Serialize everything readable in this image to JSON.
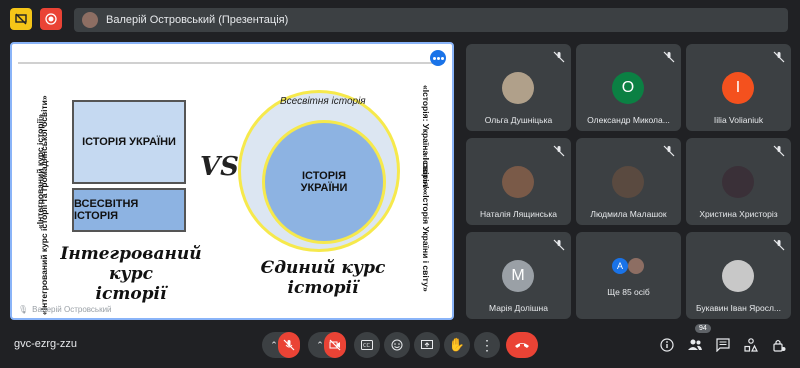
{
  "topbar": {
    "presenter_label": "Валерій Островський (Презентація)"
  },
  "slide": {
    "left_vertical_1": "«Інтегрований курс історії та громадянської освіти»",
    "left_vertical_2": "«Інтегрований курс історії»",
    "box_top": "ІСТОРІЯ УКРАЇНИ",
    "box_bottom": "ВСЕСВІТНЯ ІСТОРІЯ",
    "vs": "VS",
    "ring_outer_label": "Всесвітня історія",
    "ring_inner_label": "ІСТОРІЯ УКРАЇНИ",
    "right_vertical_1": "«Історія: Україна і світ» / «Історія України і світу»",
    "right_vertical_2": "«Історія»",
    "caption_left_1": "Інтегрований курс",
    "caption_left_2": "історії",
    "caption_right_1": "Єдиний курс",
    "caption_right_2": "історії",
    "watermark": "Валерій Островський"
  },
  "participants": [
    {
      "name": "Ольга Душніцька",
      "avatar": "photo",
      "color": "#b0a08a"
    },
    {
      "name": "Олександр Микола...",
      "avatar": "О",
      "color": "#0b8043"
    },
    {
      "name": "Iilia Volianiuk",
      "avatar": "I",
      "color": "#f4511e"
    },
    {
      "name": "Наталія Лящинська",
      "avatar": "photo",
      "color": "#7a5a48"
    },
    {
      "name": "Людмила Малашок",
      "avatar": "photo",
      "color": "#5a4a40"
    },
    {
      "name": "Христина Христоріз",
      "avatar": "photo",
      "color": "#3a3038"
    },
    {
      "name": "Марія Долішна",
      "avatar": "M",
      "color": "#9aa0a6"
    },
    {
      "name": "Ще 85 осіб",
      "avatar": "A",
      "color": "#1a73e8"
    },
    {
      "name": "Букавин Іван Яросл...",
      "avatar": "photo",
      "color": "#c8c8c8"
    }
  ],
  "bottombar": {
    "meeting_code": "gvc-ezrg-zzu",
    "participants_count": "94"
  }
}
